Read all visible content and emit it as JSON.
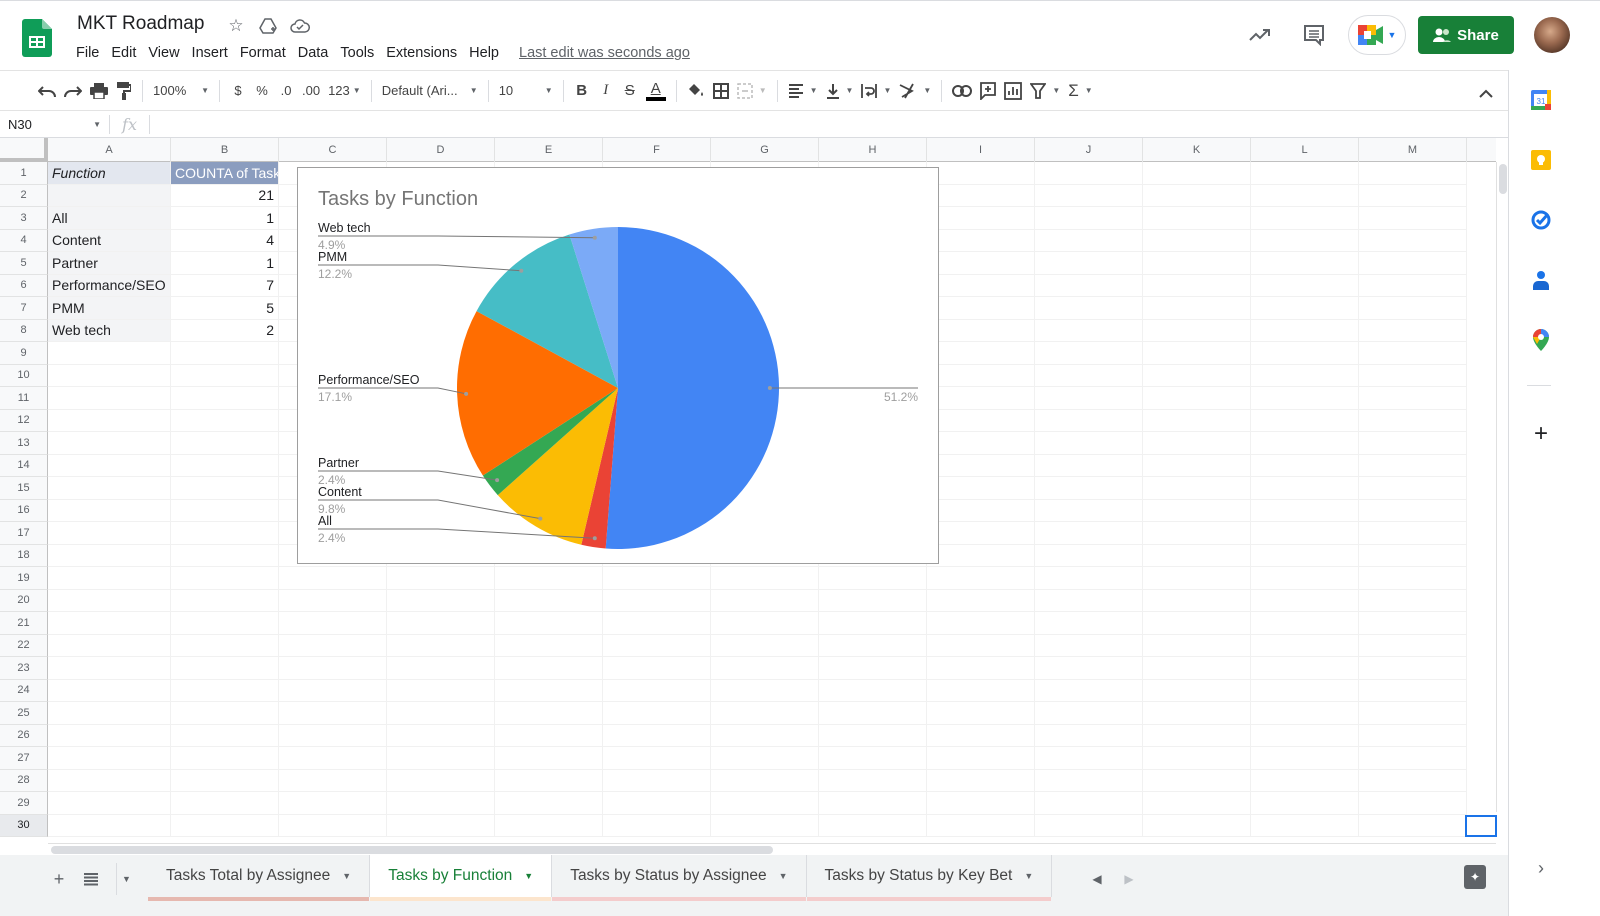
{
  "header": {
    "title": "MKT Roadmap",
    "icons": [
      "star-icon",
      "move-to-drive-icon",
      "cloud-saved-icon"
    ],
    "menu": [
      "File",
      "Edit",
      "View",
      "Insert",
      "Format",
      "Data",
      "Tools",
      "Extensions",
      "Help"
    ],
    "last_edit": "Last edit was seconds ago",
    "share_label": "Share",
    "right_icons": [
      "activity-trend-icon",
      "comments-icon",
      "meet-icon"
    ]
  },
  "toolbar": {
    "zoom": "100%",
    "currency": "$",
    "percent": "%",
    "decrease_decimal": ".0",
    "increase_decimal": ".00",
    "more_formats": "123",
    "font": "Default (Ari...",
    "font_size": "10",
    "bold": "B",
    "italic": "I",
    "strike": "S",
    "text_color": "A",
    "text_color_value": "#000000"
  },
  "formula_bar": {
    "cell_ref": "N30",
    "fx": "fx",
    "value": ""
  },
  "grid": {
    "columns": [
      "A",
      "B",
      "C",
      "D",
      "E",
      "F",
      "G",
      "H",
      "I",
      "J",
      "K",
      "L",
      "M"
    ],
    "row_count": 30,
    "active_row": 30,
    "cells": [
      {
        "a": "Function",
        "b": "COUNTA of Task"
      },
      {
        "a": "",
        "b": "21"
      },
      {
        "a": "All",
        "b": "1"
      },
      {
        "a": "Content",
        "b": "4"
      },
      {
        "a": "Partner",
        "b": "1"
      },
      {
        "a": "Performance/SEO",
        "b": "7"
      },
      {
        "a": "PMM",
        "b": "5"
      },
      {
        "a": "Web tech",
        "b": "2"
      }
    ]
  },
  "chart_data": {
    "type": "pie",
    "title": "Tasks by Function",
    "slices": [
      {
        "label": "",
        "value": 21,
        "percent": "51.2%",
        "color": "#4285f4"
      },
      {
        "label": "All",
        "value": 1,
        "percent": "2.4%",
        "color": "#ea4335"
      },
      {
        "label": "Content",
        "value": 4,
        "percent": "9.8%",
        "color": "#fbbc04"
      },
      {
        "label": "Partner",
        "value": 1,
        "percent": "2.4%",
        "color": "#34a853"
      },
      {
        "label": "Performance/SEO",
        "value": 7,
        "percent": "17.1%",
        "color": "#ff6d01"
      },
      {
        "label": "PMM",
        "value": 5,
        "percent": "12.2%",
        "color": "#46bdc6"
      },
      {
        "label": "Web tech",
        "value": 2,
        "percent": "4.9%",
        "color": "#7baaf7"
      }
    ],
    "legend": "labels"
  },
  "sheets": {
    "tabs": [
      {
        "label": "Tasks Total by Assignee",
        "active": false,
        "color": "#e6b8af"
      },
      {
        "label": "Tasks by Function",
        "active": true,
        "color": "#fce5cd"
      },
      {
        "label": "Tasks by Status by Assignee",
        "active": false,
        "color": "#f4cccc"
      },
      {
        "label": "Tasks by Status by Key Bet",
        "active": false,
        "color": "#f4cccc"
      }
    ]
  },
  "side_panel": {
    "apps": [
      "calendar-icon",
      "keep-icon",
      "tasks-icon",
      "contacts-icon",
      "maps-icon"
    ],
    "add_label": "+"
  }
}
